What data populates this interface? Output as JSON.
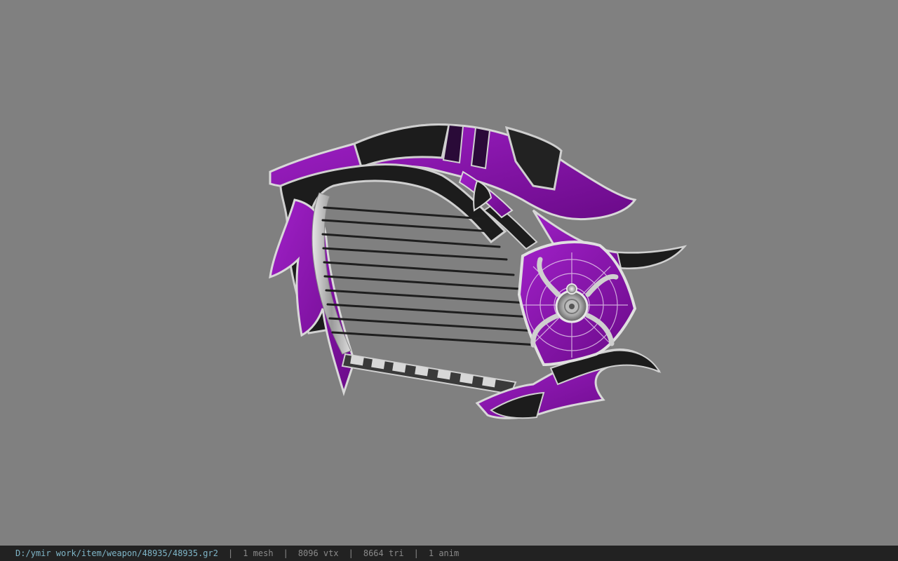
{
  "viewer": {
    "background_color": "#808080",
    "model_colors": {
      "purple": "#8a1aa8",
      "black": "#1c1c1c",
      "silver": "#c8c8c8",
      "string": "#222222"
    }
  },
  "statusbar": {
    "file_path": "D:/ymir work/item/weapon/48935/48935.gr2",
    "mesh_count": "1 mesh",
    "vertex_count": "8096 vtx",
    "triangle_count": "8664 tri",
    "anim_count": "1 anim",
    "separator": "|"
  }
}
